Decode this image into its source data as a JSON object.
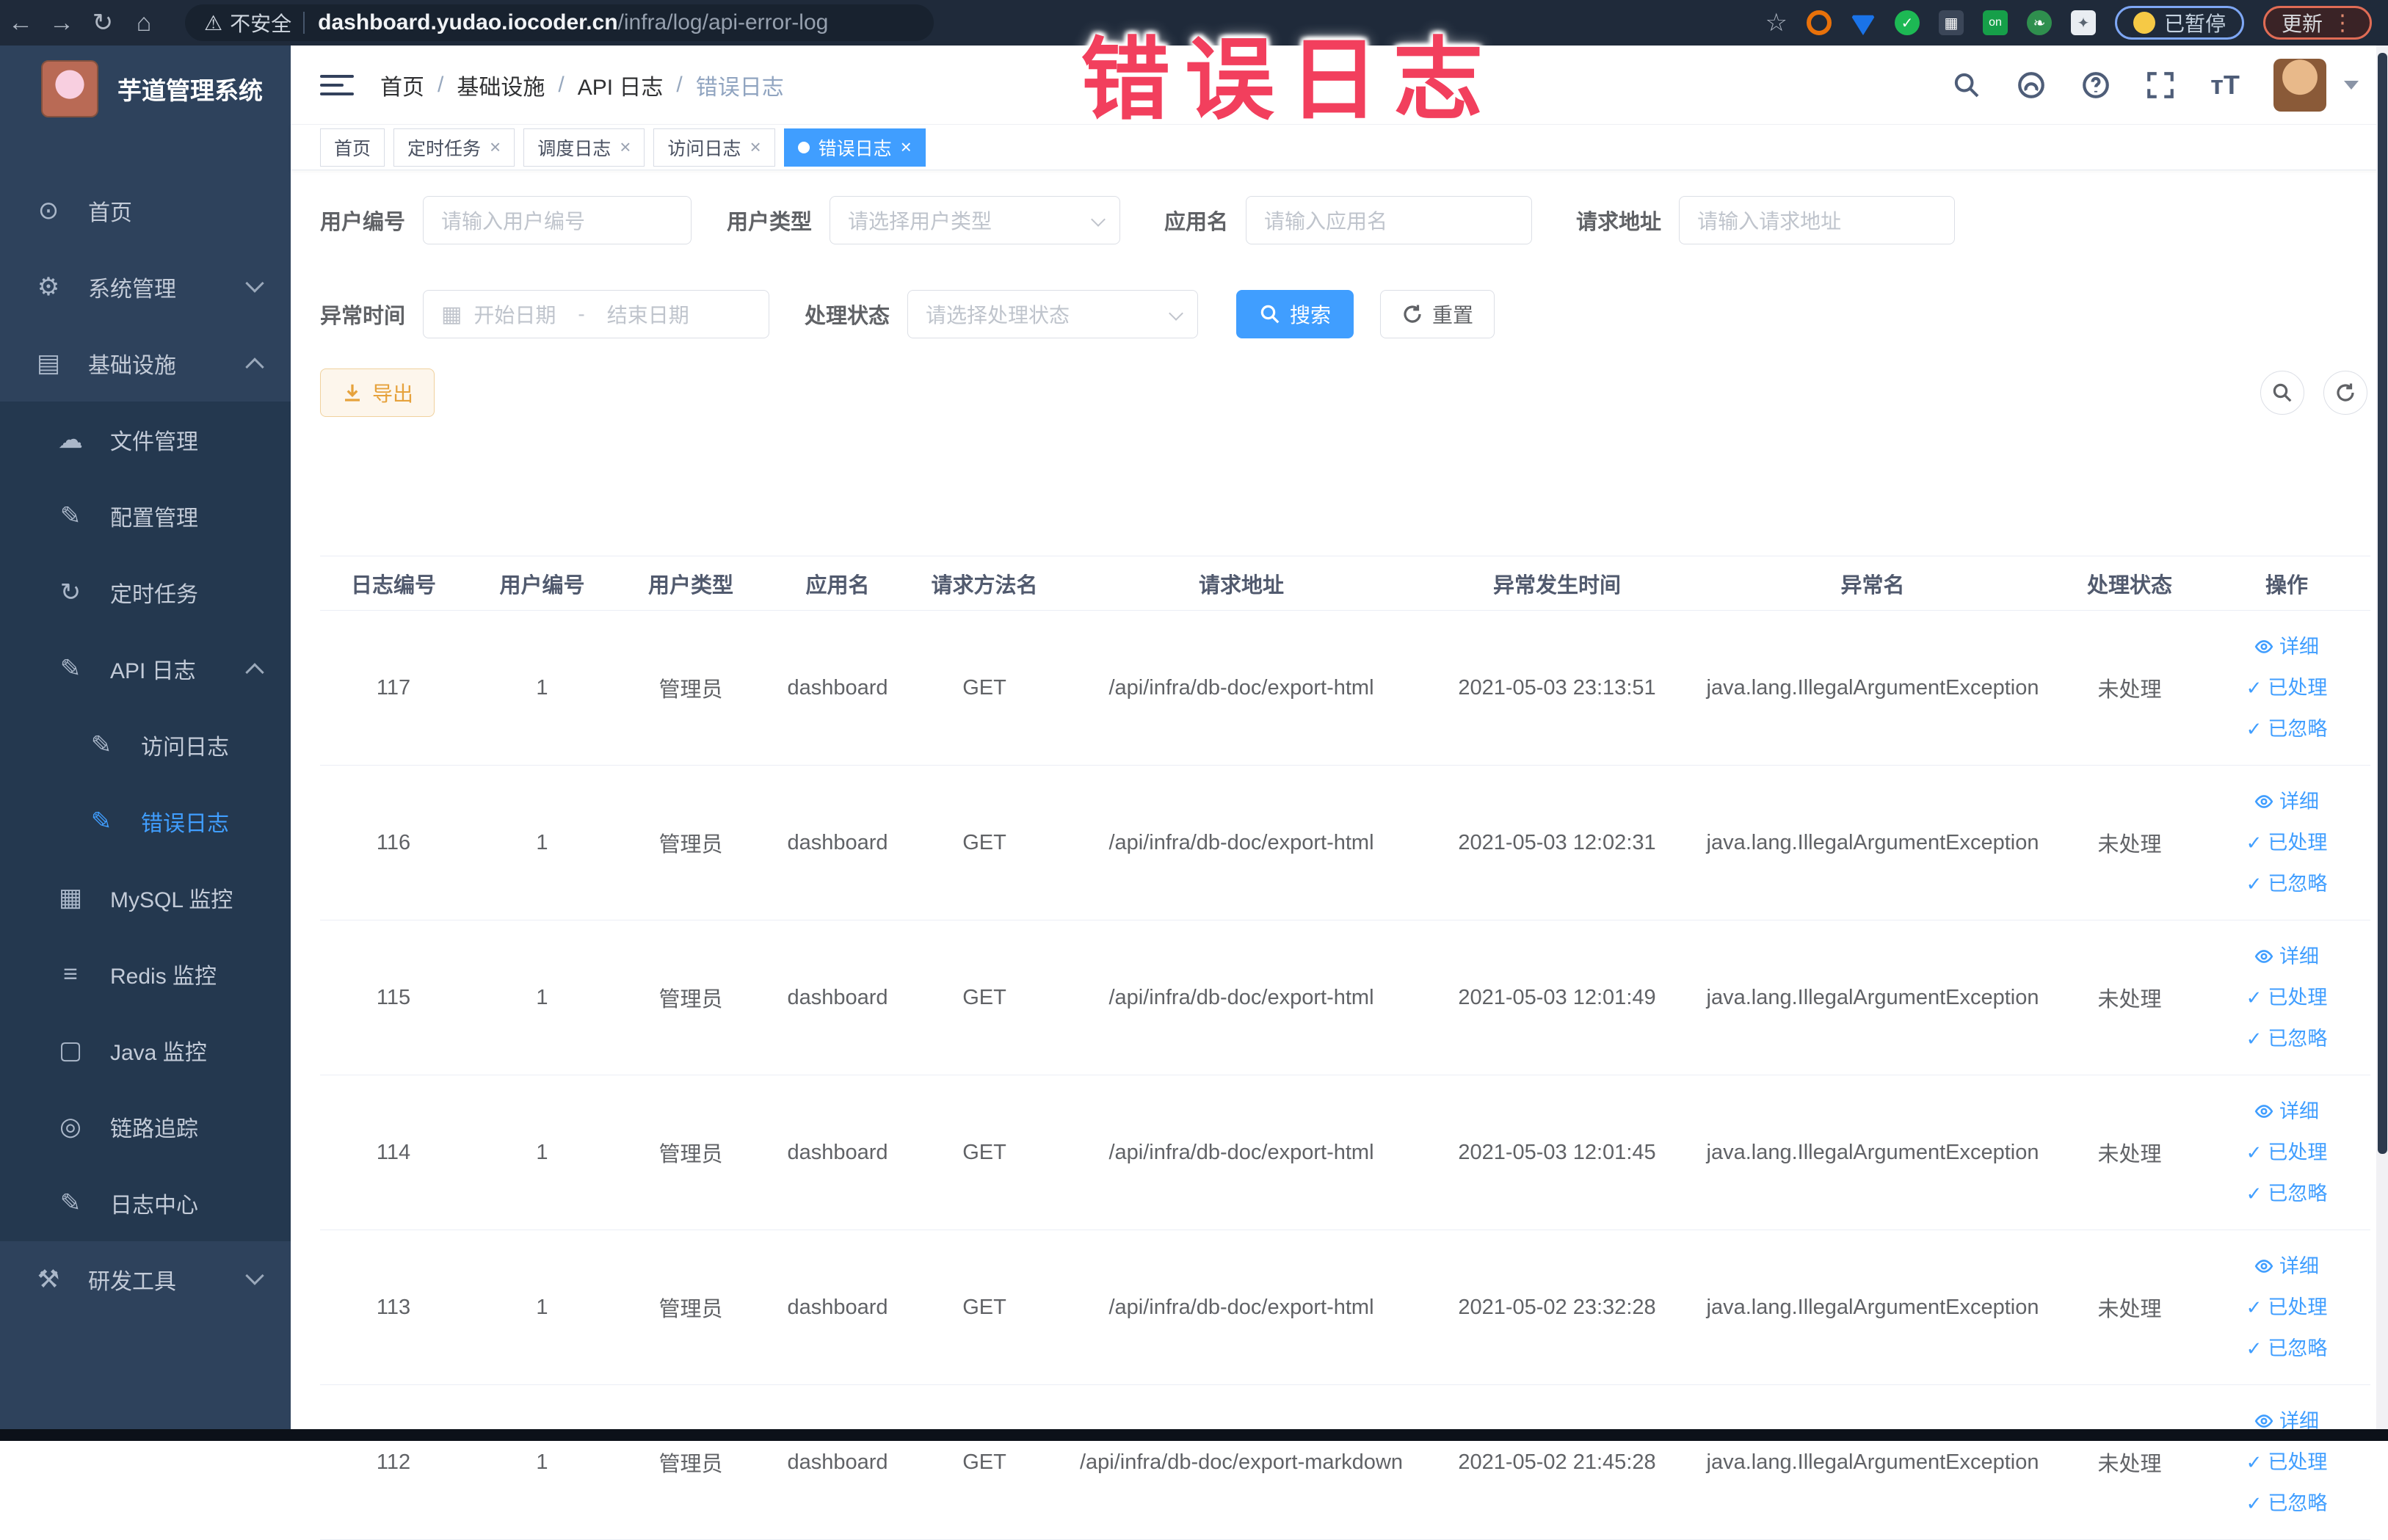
{
  "browser": {
    "security_label": "不安全",
    "url_domain": "dashboard.yudao.iocoder.cn",
    "url_path": "/infra/log/api-error-log",
    "paused_label": "已暂停",
    "update_label": "更新",
    "kebab": "⋮",
    "icons": {
      "back": "←",
      "forward": "→",
      "reload": "↻",
      "home": "⌂",
      "warning": "⚠",
      "star": "☆",
      "ext_badge": "on"
    }
  },
  "overlay": {
    "title": "错误日志",
    "color": "#f23f5d"
  },
  "sidebar": {
    "app_title": "芋道管理系统",
    "items": [
      {
        "label": "首页",
        "icon": "home-icon",
        "glyph": "⊙"
      },
      {
        "label": "系统管理",
        "icon": "gear-icon",
        "glyph": "⚙"
      },
      {
        "label": "基础设施",
        "icon": "monitor-icon",
        "glyph": "▤"
      },
      {
        "label": "文件管理",
        "icon": "cloud-upload-icon",
        "glyph": "☁"
      },
      {
        "label": "配置管理",
        "icon": "edit-icon",
        "glyph": "✎"
      },
      {
        "label": "定时任务",
        "icon": "timer-icon",
        "glyph": "↻"
      },
      {
        "label": "API 日志",
        "icon": "log-edit-icon",
        "glyph": "✎"
      },
      {
        "label": "访问日志",
        "icon": "log-edit-icon",
        "glyph": "✎"
      },
      {
        "label": "错误日志",
        "icon": "log-edit-icon",
        "glyph": "✎"
      },
      {
        "label": "MySQL 监控",
        "icon": "database-icon",
        "glyph": "▦"
      },
      {
        "label": "Redis 监控",
        "icon": "layers-icon",
        "glyph": "≡"
      },
      {
        "label": "Java 监控",
        "icon": "screen-icon",
        "glyph": "▢"
      },
      {
        "label": "链路追踪",
        "icon": "eye-icon",
        "glyph": "◎"
      },
      {
        "label": "日志中心",
        "icon": "log-doc-icon",
        "glyph": "✎"
      },
      {
        "label": "研发工具",
        "icon": "toolbox-icon",
        "glyph": "⚒"
      }
    ]
  },
  "breadcrumb": {
    "sep": "/",
    "items": [
      "首页",
      "基础设施",
      "API 日志",
      "错误日志"
    ]
  },
  "tags": {
    "close": "×",
    "items": [
      {
        "label": "首页"
      },
      {
        "label": "定时任务"
      },
      {
        "label": "调度日志"
      },
      {
        "label": "访问日志"
      },
      {
        "label": "错误日志"
      }
    ]
  },
  "filters": {
    "user_id_label": "用户编号",
    "user_id_placeholder": "请输入用户编号",
    "user_type_label": "用户类型",
    "user_type_placeholder": "请选择用户类型",
    "app_name_label": "应用名",
    "app_name_placeholder": "请输入应用名",
    "request_url_label": "请求地址",
    "request_url_placeholder": "请输入请求地址",
    "exception_time_label": "异常时间",
    "date_start_placeholder": "开始日期",
    "date_sep": "-",
    "date_end_placeholder": "结束日期",
    "calendar_glyph": "▦",
    "process_status_label": "处理状态",
    "process_status_placeholder": "请选择处理状态",
    "search_label": "搜索",
    "reset_label": "重置"
  },
  "toolbar": {
    "export_label": "导出"
  },
  "table": {
    "columns": [
      "日志编号",
      "用户编号",
      "用户类型",
      "应用名",
      "请求方法名",
      "请求地址",
      "异常发生时间",
      "异常名",
      "处理状态",
      "操作"
    ],
    "action_detail": "详细",
    "action_processed": "已处理",
    "action_ignored": "已忽略",
    "check_glyph": "✓",
    "rows": [
      {
        "id": "117",
        "user_id": "1",
        "user_type": "管理员",
        "app": "dashboard",
        "method": "GET",
        "url": "/api/infra/db-doc/export-html",
        "time": "2021-05-03 23:13:51",
        "exception": "java.lang.IllegalArgumentException",
        "status": "未处理"
      },
      {
        "id": "116",
        "user_id": "1",
        "user_type": "管理员",
        "app": "dashboard",
        "method": "GET",
        "url": "/api/infra/db-doc/export-html",
        "time": "2021-05-03 12:02:31",
        "exception": "java.lang.IllegalArgumentException",
        "status": "未处理"
      },
      {
        "id": "115",
        "user_id": "1",
        "user_type": "管理员",
        "app": "dashboard",
        "method": "GET",
        "url": "/api/infra/db-doc/export-html",
        "time": "2021-05-03 12:01:49",
        "exception": "java.lang.IllegalArgumentException",
        "status": "未处理"
      },
      {
        "id": "114",
        "user_id": "1",
        "user_type": "管理员",
        "app": "dashboard",
        "method": "GET",
        "url": "/api/infra/db-doc/export-html",
        "time": "2021-05-03 12:01:45",
        "exception": "java.lang.IllegalArgumentException",
        "status": "未处理"
      },
      {
        "id": "113",
        "user_id": "1",
        "user_type": "管理员",
        "app": "dashboard",
        "method": "GET",
        "url": "/api/infra/db-doc/export-html",
        "time": "2021-05-02 23:32:28",
        "exception": "java.lang.IllegalArgumentException",
        "status": "未处理"
      },
      {
        "id": "112",
        "user_id": "1",
        "user_type": "管理员",
        "app": "dashboard",
        "method": "GET",
        "url": "/api/infra/db-doc/export-markdown",
        "time": "2021-05-02 21:45:28",
        "exception": "java.lang.IllegalArgumentException",
        "status": "未处理"
      }
    ]
  },
  "colors": {
    "accent": "#409eff",
    "warn": "#e6a23c",
    "sidebar_bg": "#2e425c",
    "submenu_bg": "#24384f",
    "overlay_red": "#f23f5d"
  }
}
